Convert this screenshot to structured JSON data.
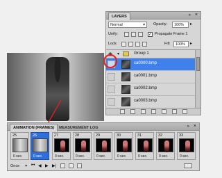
{
  "layers_panel": {
    "tab_label": "LAYERS",
    "blend_mode": "Normal",
    "opacity_label": "Opacity:",
    "opacity_value": "100%",
    "unify_label": "Unify:",
    "propagate_label": "Propagate Frame 1",
    "lock_label": "Lock:",
    "fill_label": "Fill:",
    "fill_value": "100%",
    "group_name": "Group 1",
    "layers": [
      "ca0000.bmp",
      "ca0001.bmp",
      "ca0002.bmp",
      "ca0003.bmp"
    ]
  },
  "animation_panel": {
    "tabs": [
      "ANIMATION (FRAMES)",
      "MEASUREMENT LOG"
    ],
    "frames": [
      {
        "number": "25",
        "delay": "0 sec."
      },
      {
        "number": "26",
        "delay": "0 sec."
      },
      {
        "number": "27",
        "delay": "0 sec."
      },
      {
        "number": "28",
        "delay": "0 sec."
      },
      {
        "number": "29",
        "delay": "0 sec."
      },
      {
        "number": "30",
        "delay": "0 sec."
      },
      {
        "number": "31",
        "delay": "0 sec."
      },
      {
        "number": "32",
        "delay": "0 sec."
      },
      {
        "number": "33",
        "delay": "0 sec."
      }
    ],
    "loop_option": "Once"
  },
  "colors": {
    "selection": "#3f80ea",
    "annotation": "#e02020"
  }
}
